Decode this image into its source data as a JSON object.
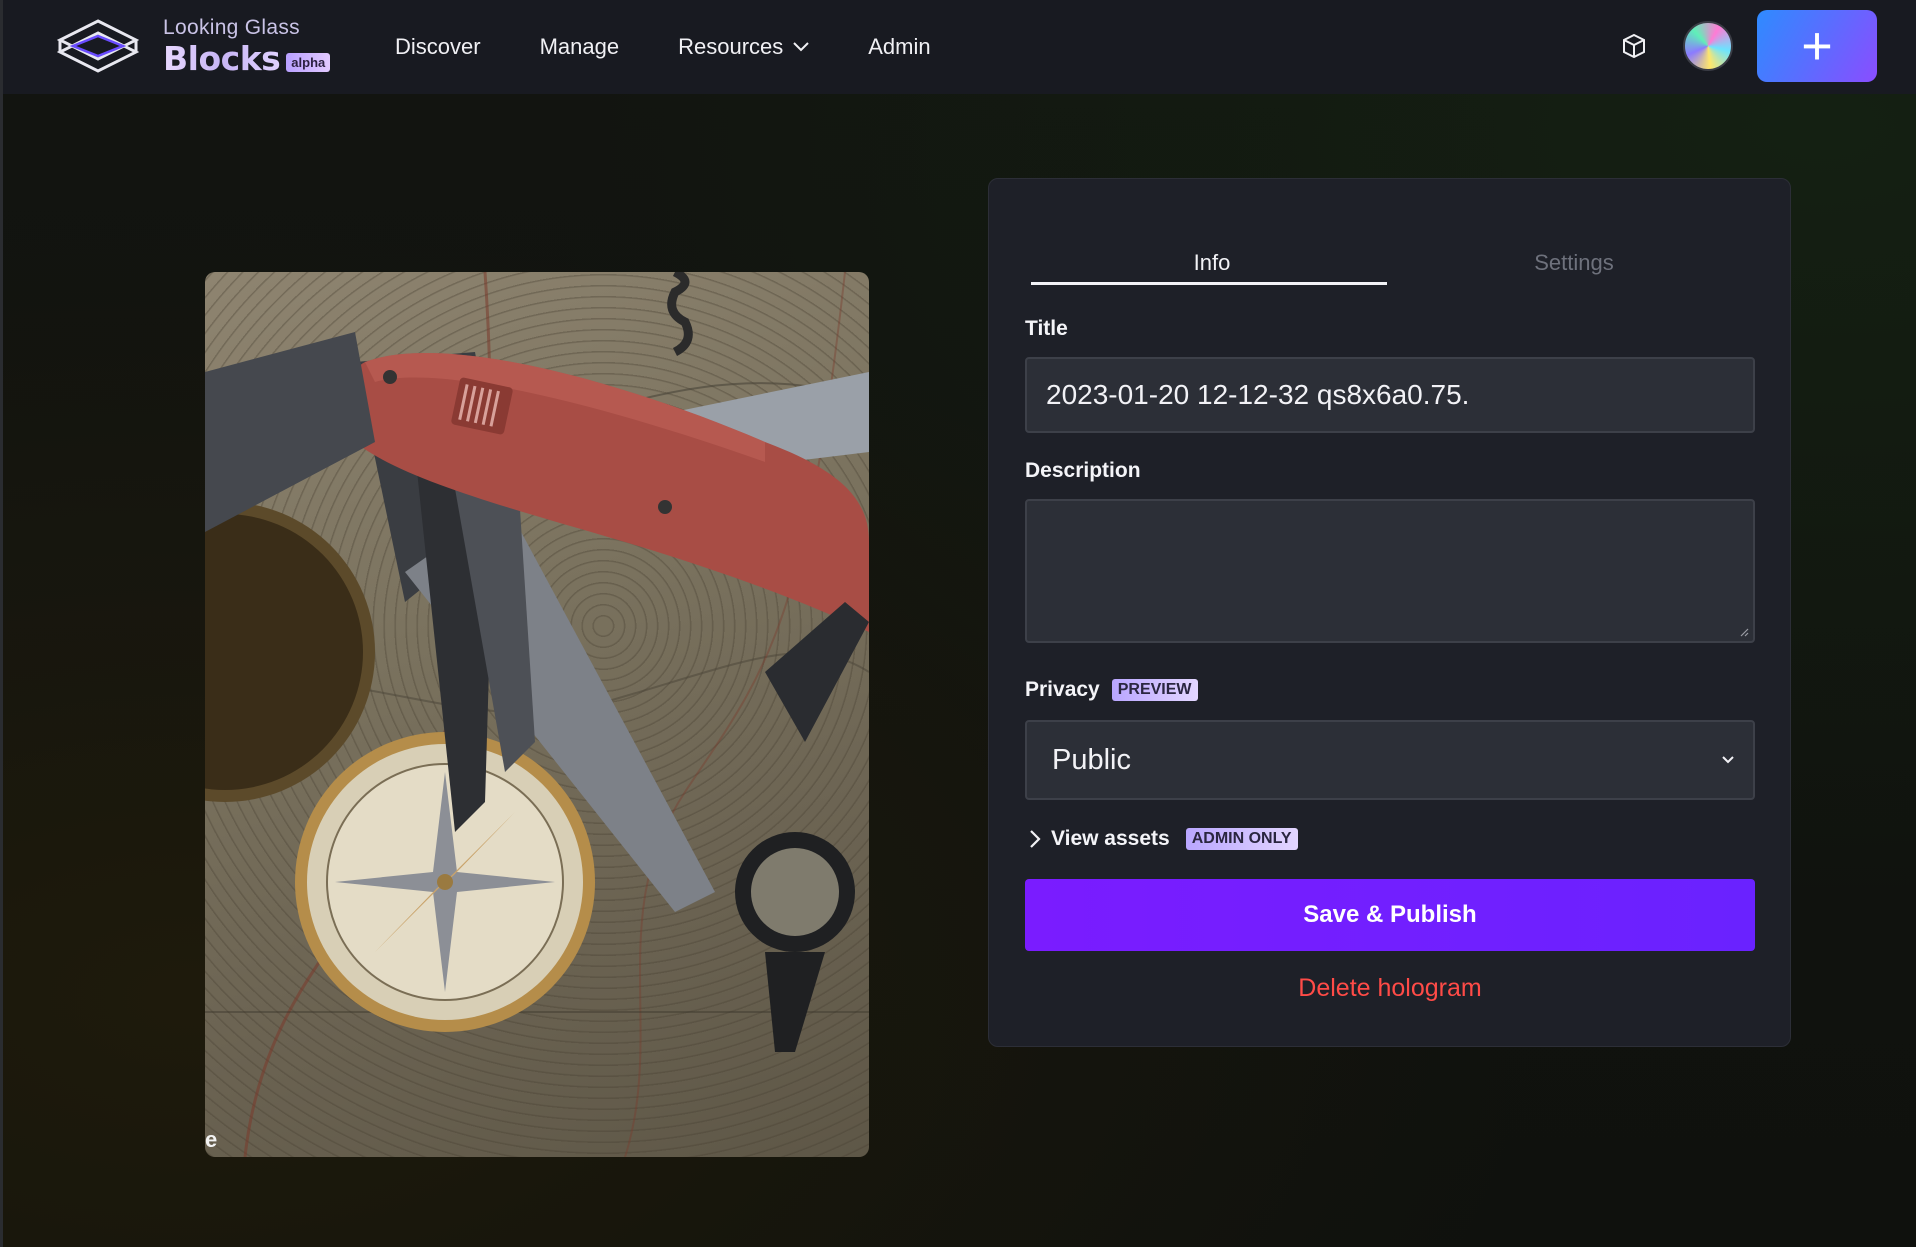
{
  "header": {
    "brand_small": "Looking Glass",
    "brand_big": "Blocks",
    "brand_badge": "alpha",
    "nav": [
      {
        "label": "Discover"
      },
      {
        "label": "Manage"
      },
      {
        "label": "Resources"
      },
      {
        "label": "Admin"
      }
    ],
    "add_label": "+"
  },
  "hologram": {
    "corner_text": "e"
  },
  "panel": {
    "tabs": [
      {
        "label": "Info",
        "active": true
      },
      {
        "label": "Settings",
        "active": false
      }
    ],
    "title_label": "Title",
    "title_value": "2023-01-20 12-12-32 qs8x6a0.75.",
    "description_label": "Description",
    "description_value": "",
    "privacy_label": "Privacy",
    "privacy_badge": "PREVIEW",
    "privacy_value": "Public",
    "assets_label": "View assets",
    "assets_badge": "ADMIN ONLY",
    "save_label": "Save & Publish",
    "delete_label": "Delete hologram"
  },
  "colors": {
    "accent": "#7a1cff",
    "danger": "#ff4b47",
    "panel_bg": "#1e2028",
    "header_bg": "#181a21"
  },
  "icons": [
    "logo-icon",
    "chevron-down-icon",
    "cube-icon",
    "avatar",
    "plus-icon",
    "chevron-right-icon",
    "resize-grip-icon"
  ]
}
